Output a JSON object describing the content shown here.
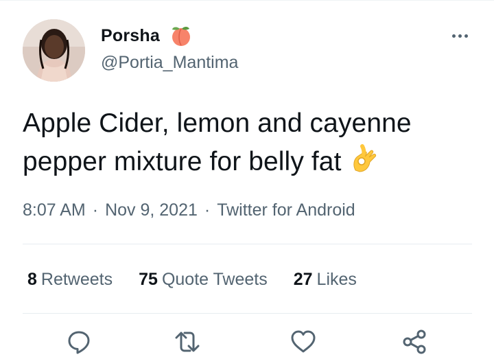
{
  "author": {
    "display_name": "Porsha",
    "name_emoji": "peach-emoji",
    "handle": "@Portia_Mantima"
  },
  "tweet": {
    "text_line1": "Apple Cider, lemon and cayenne",
    "text_line2": "pepper mixture for belly fat",
    "trailing_emoji": "ok-hand-emoji"
  },
  "meta": {
    "time": "8:07 AM",
    "separator": "·",
    "date": "Nov 9, 2021",
    "source": "Twitter for Android"
  },
  "stats": {
    "retweets": {
      "count": "8",
      "label": "Retweets"
    },
    "quote_tweets": {
      "count": "75",
      "label": "Quote Tweets"
    },
    "likes": {
      "count": "27",
      "label": "Likes"
    }
  },
  "actions": [
    "reply-icon",
    "retweet-icon",
    "like-icon",
    "share-icon"
  ],
  "colors": {
    "text_primary": "#0f1419",
    "text_secondary": "#536471",
    "divider": "#e6ecf0",
    "peach": "#f7836a",
    "ok_hand": "#ffc83d"
  }
}
